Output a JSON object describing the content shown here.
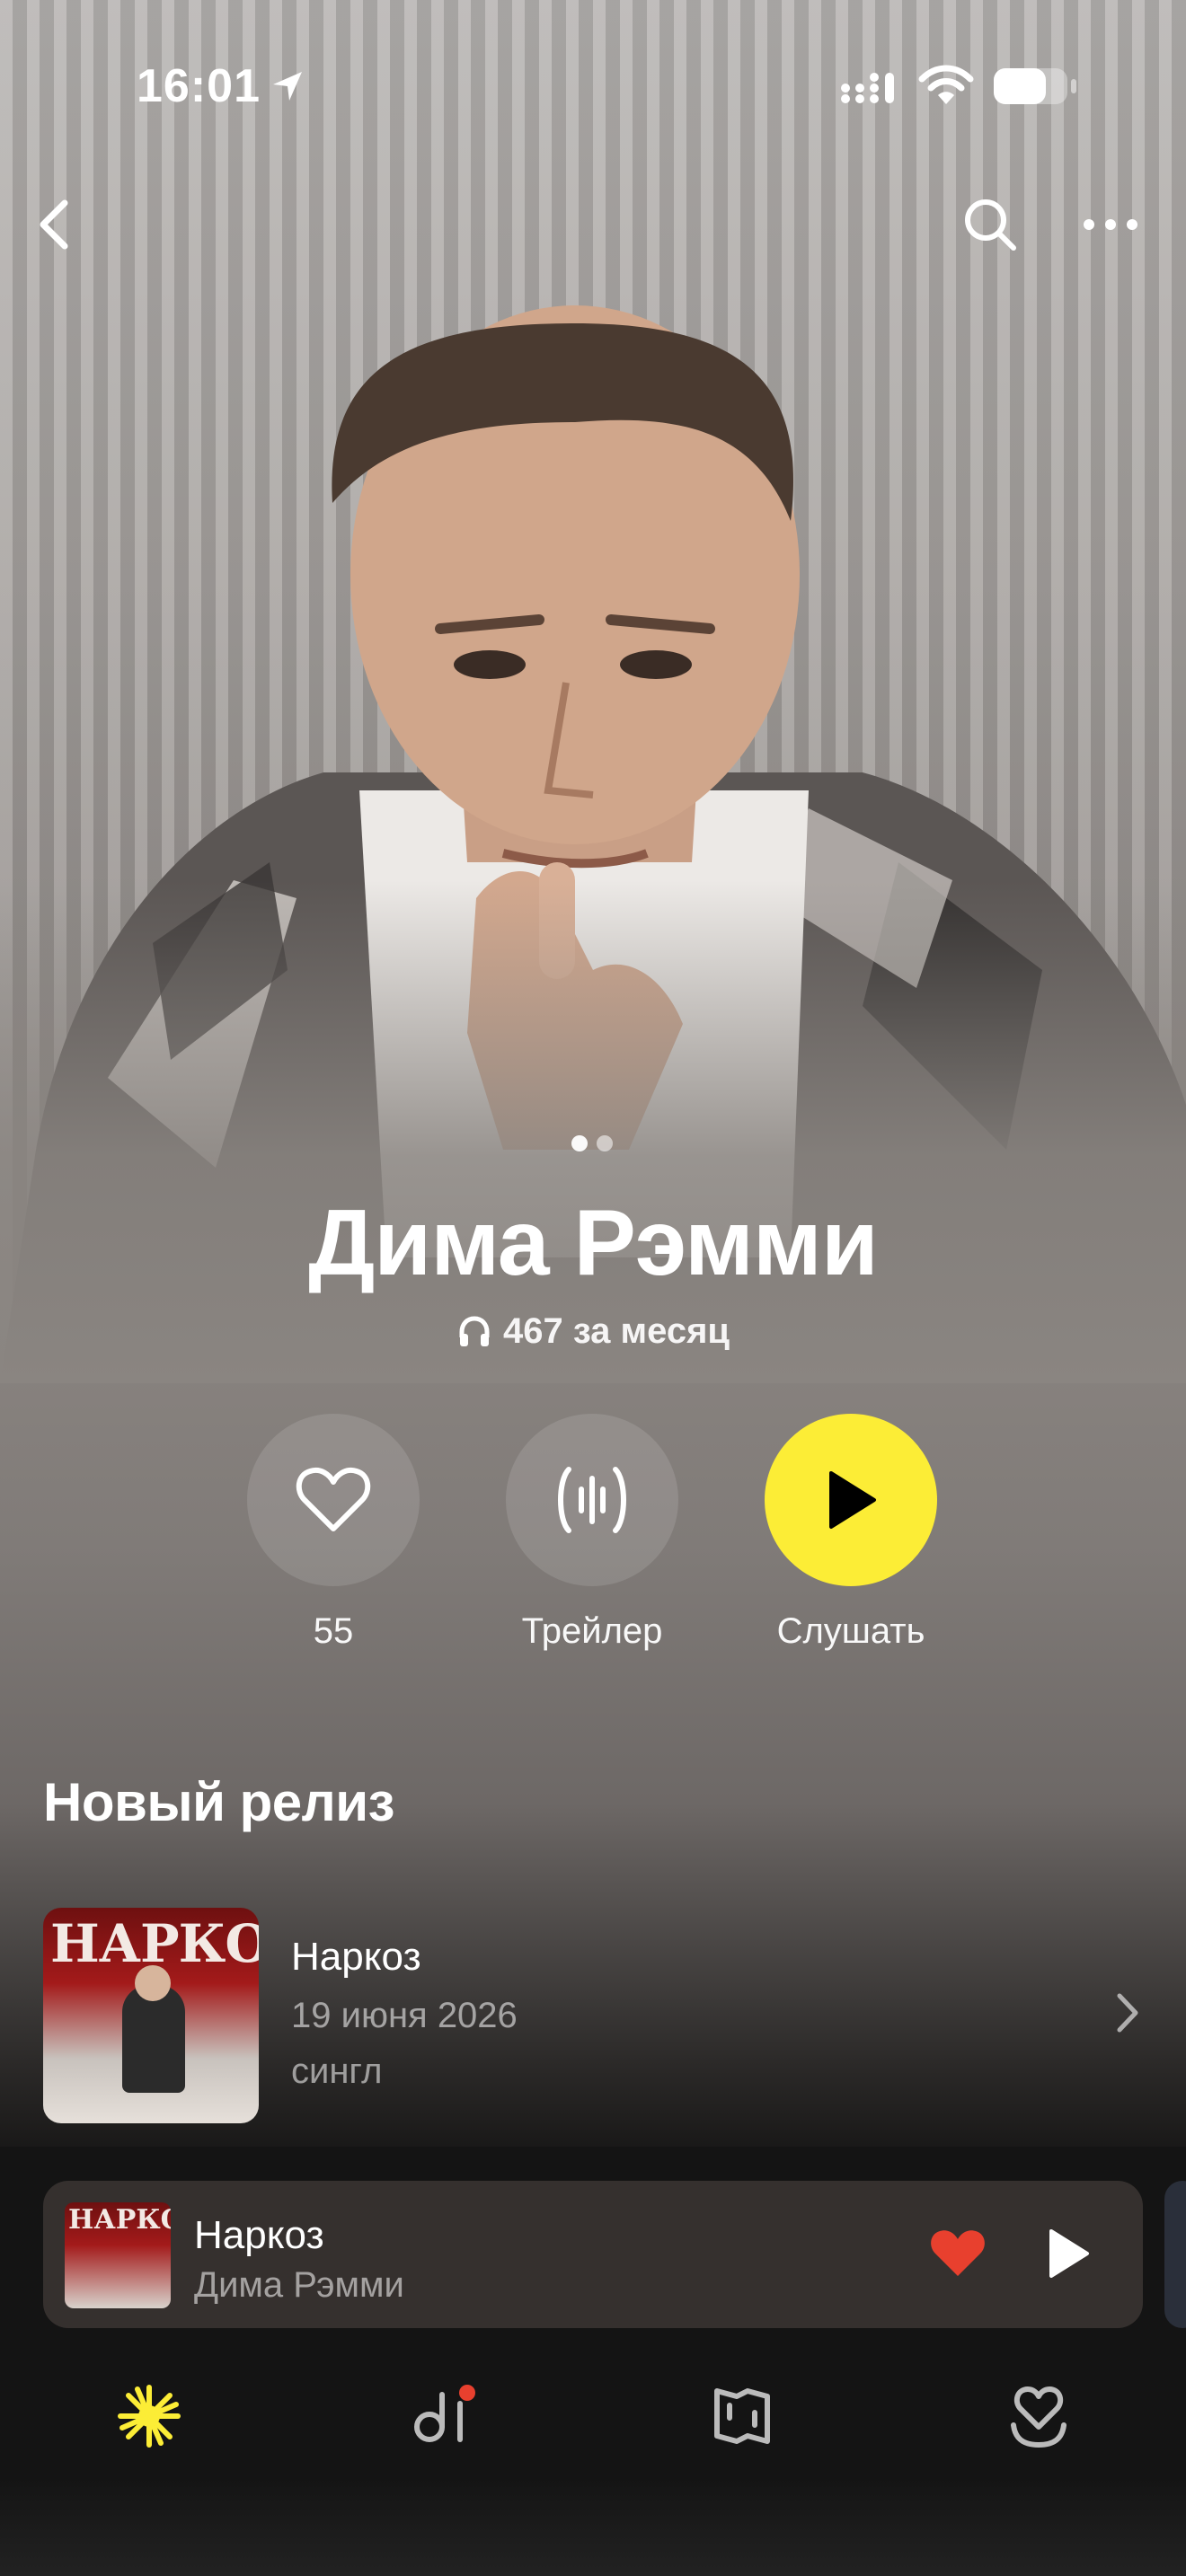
{
  "status_bar": {
    "time": "16:01",
    "icons": [
      "location-arrow-icon",
      "signal-icon",
      "wifi-icon",
      "battery-icon"
    ]
  },
  "nav": {
    "back_icon": "chevron-left-icon",
    "search_icon": "search-icon",
    "more_icon": "more-dots-icon"
  },
  "hero": {
    "page_indicator": {
      "total": 2,
      "active": 1
    }
  },
  "artist": {
    "name": "Дима Рэмми",
    "listeners": "467 за месяц",
    "listeners_icon": "headphones-icon"
  },
  "actions": {
    "like_count": "55",
    "trailer_label": "Трейлер",
    "listen_label": "Слушать",
    "accent_color": "#fced36"
  },
  "new_release": {
    "section_title": "Новый релиз",
    "cover_text": "НАРКОЗ",
    "title": "Наркоз",
    "date": "19 июня 2026",
    "type": "сингл"
  },
  "mini_player": {
    "cover_text": "НАРКОЗ",
    "title": "Наркоз",
    "artist": "Дима Рэмми",
    "liked": true,
    "heart_color": "#e8402e"
  },
  "tabbar": {
    "tabs": [
      {
        "icon": "wave-star-icon",
        "active": true
      },
      {
        "icon": "music-collection-icon",
        "badge": true
      },
      {
        "icon": "map-icon"
      },
      {
        "icon": "favorites-heart-icon"
      }
    ]
  }
}
